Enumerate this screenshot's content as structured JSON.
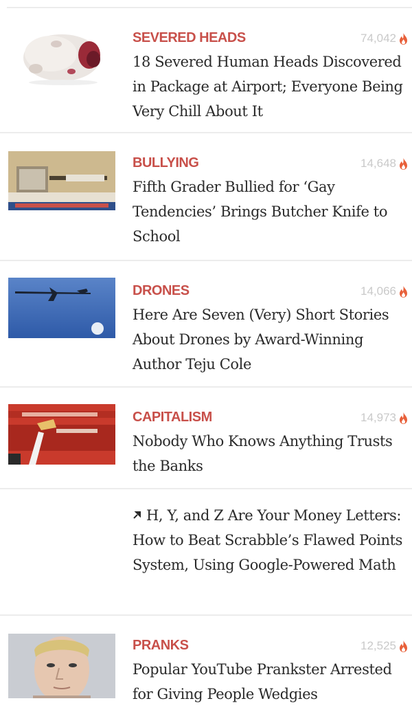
{
  "feed": {
    "stories": [
      {
        "category": "SEVERED HEADS",
        "count": "74,042",
        "headline": "18 Severed Human Heads Discovered in Package at Airport; Everyone Being Very Chill About It"
      },
      {
        "category": "BULLYING",
        "count": "14,648",
        "headline": "Fifth Grader Bullied for ‘Gay Tendencies’ Brings Butcher Knife to School"
      },
      {
        "category": "DRONES",
        "count": "14,066",
        "headline": "Here Are Seven (Very) Short Stories About Drones by Award-Winning Author Teju Cole"
      },
      {
        "category": "CAPITALISM",
        "count": "14,973",
        "headline": "Nobody Who Knows Anything Trusts the Banks"
      },
      {
        "headline": "H, Y, and Z Are Your Money Letters: How to Beat Scrabble’s Flawed Points System, Using Google-Powered Math"
      },
      {
        "category": "PRANKS",
        "count": "12,525",
        "headline": "Popular YouTube Prankster Arrested for Giving People Wedgies"
      }
    ]
  },
  "colors": {
    "category": "#c8504a",
    "count": "#c9c9c9",
    "flame": "#e8603a",
    "headline": "#2a2a2a",
    "divider": "#ececec"
  },
  "icons": {
    "count": "flame-icon",
    "external": "pin-icon"
  }
}
